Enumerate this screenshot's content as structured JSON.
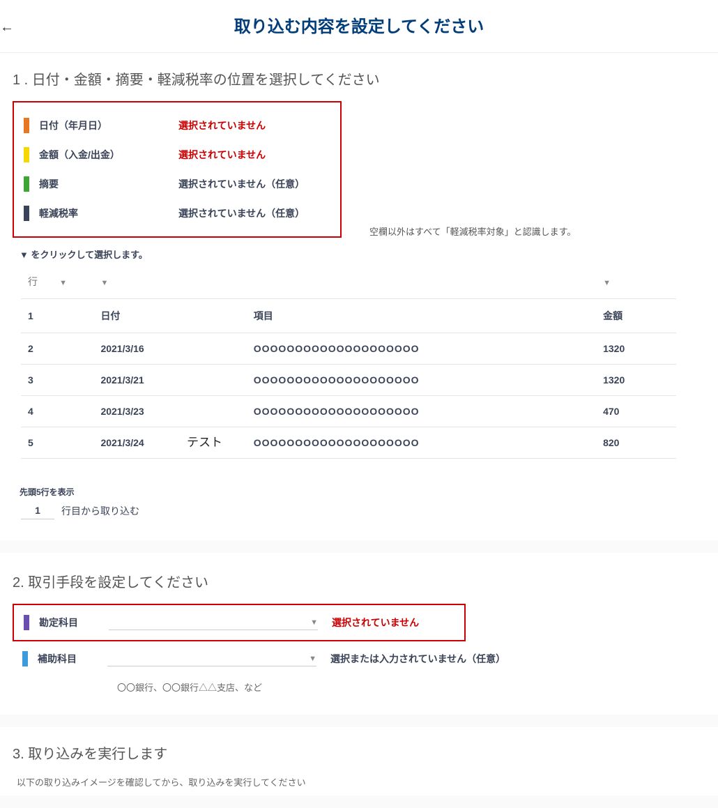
{
  "header": {
    "title": "取り込む内容を設定してください"
  },
  "section1": {
    "title": "1 . 日付・金額・摘要・軽減税率の位置を選択してください",
    "legend": [
      {
        "label": "日付（年月日）",
        "status": "選択されていません",
        "required": true
      },
      {
        "label": "金額（入金/出金）",
        "status": "選択されていません",
        "required": true
      },
      {
        "label": "摘要",
        "status": "選択されていません（任意）",
        "required": false
      },
      {
        "label": "軽減税率",
        "status": "選択されていません（任意）",
        "required": false
      }
    ],
    "note": "空欄以外はすべて「軽減税率対象」と認識します。",
    "hint": "▼ をクリックして選択します。",
    "table": {
      "headers": {
        "row": "行",
        "date": "日付",
        "item": "項目",
        "amount": "金額"
      },
      "rows": [
        {
          "n": "1",
          "date": "",
          "item": "",
          "amount": ""
        },
        {
          "n": "2",
          "date": "2021/3/16",
          "item": "OOOOOOOOOOOOOOOOOOOO",
          "amount": "1320"
        },
        {
          "n": "3",
          "date": "2021/3/21",
          "item": "OOOOOOOOOOOOOOOOOOOO",
          "amount": "1320"
        },
        {
          "n": "4",
          "date": "2021/3/23",
          "item": "OOOOOOOOOOOOOOOOOOOO",
          "amount": "470"
        },
        {
          "n": "5",
          "date": "2021/3/24",
          "item": "OOOOOOOOOOOOOOOOOOOO",
          "amount": "820"
        }
      ]
    },
    "test_label": "テスト",
    "footer_note": "先頭5行を表示",
    "import_from_value": "1",
    "import_from_label": "行目から取り込む"
  },
  "section2": {
    "title": "2. 取引手段を設定してください",
    "account": {
      "label": "勘定科目",
      "status": "選択されていません"
    },
    "sub_account": {
      "label": "補助科目",
      "status": "選択または入力されていません（任意）",
      "hint": "〇〇銀行、〇〇銀行△△支店、など"
    }
  },
  "section3": {
    "title": "3. 取り込みを実行します",
    "note": "以下の取り込みイメージを確認してから、取り込みを実行してください"
  }
}
